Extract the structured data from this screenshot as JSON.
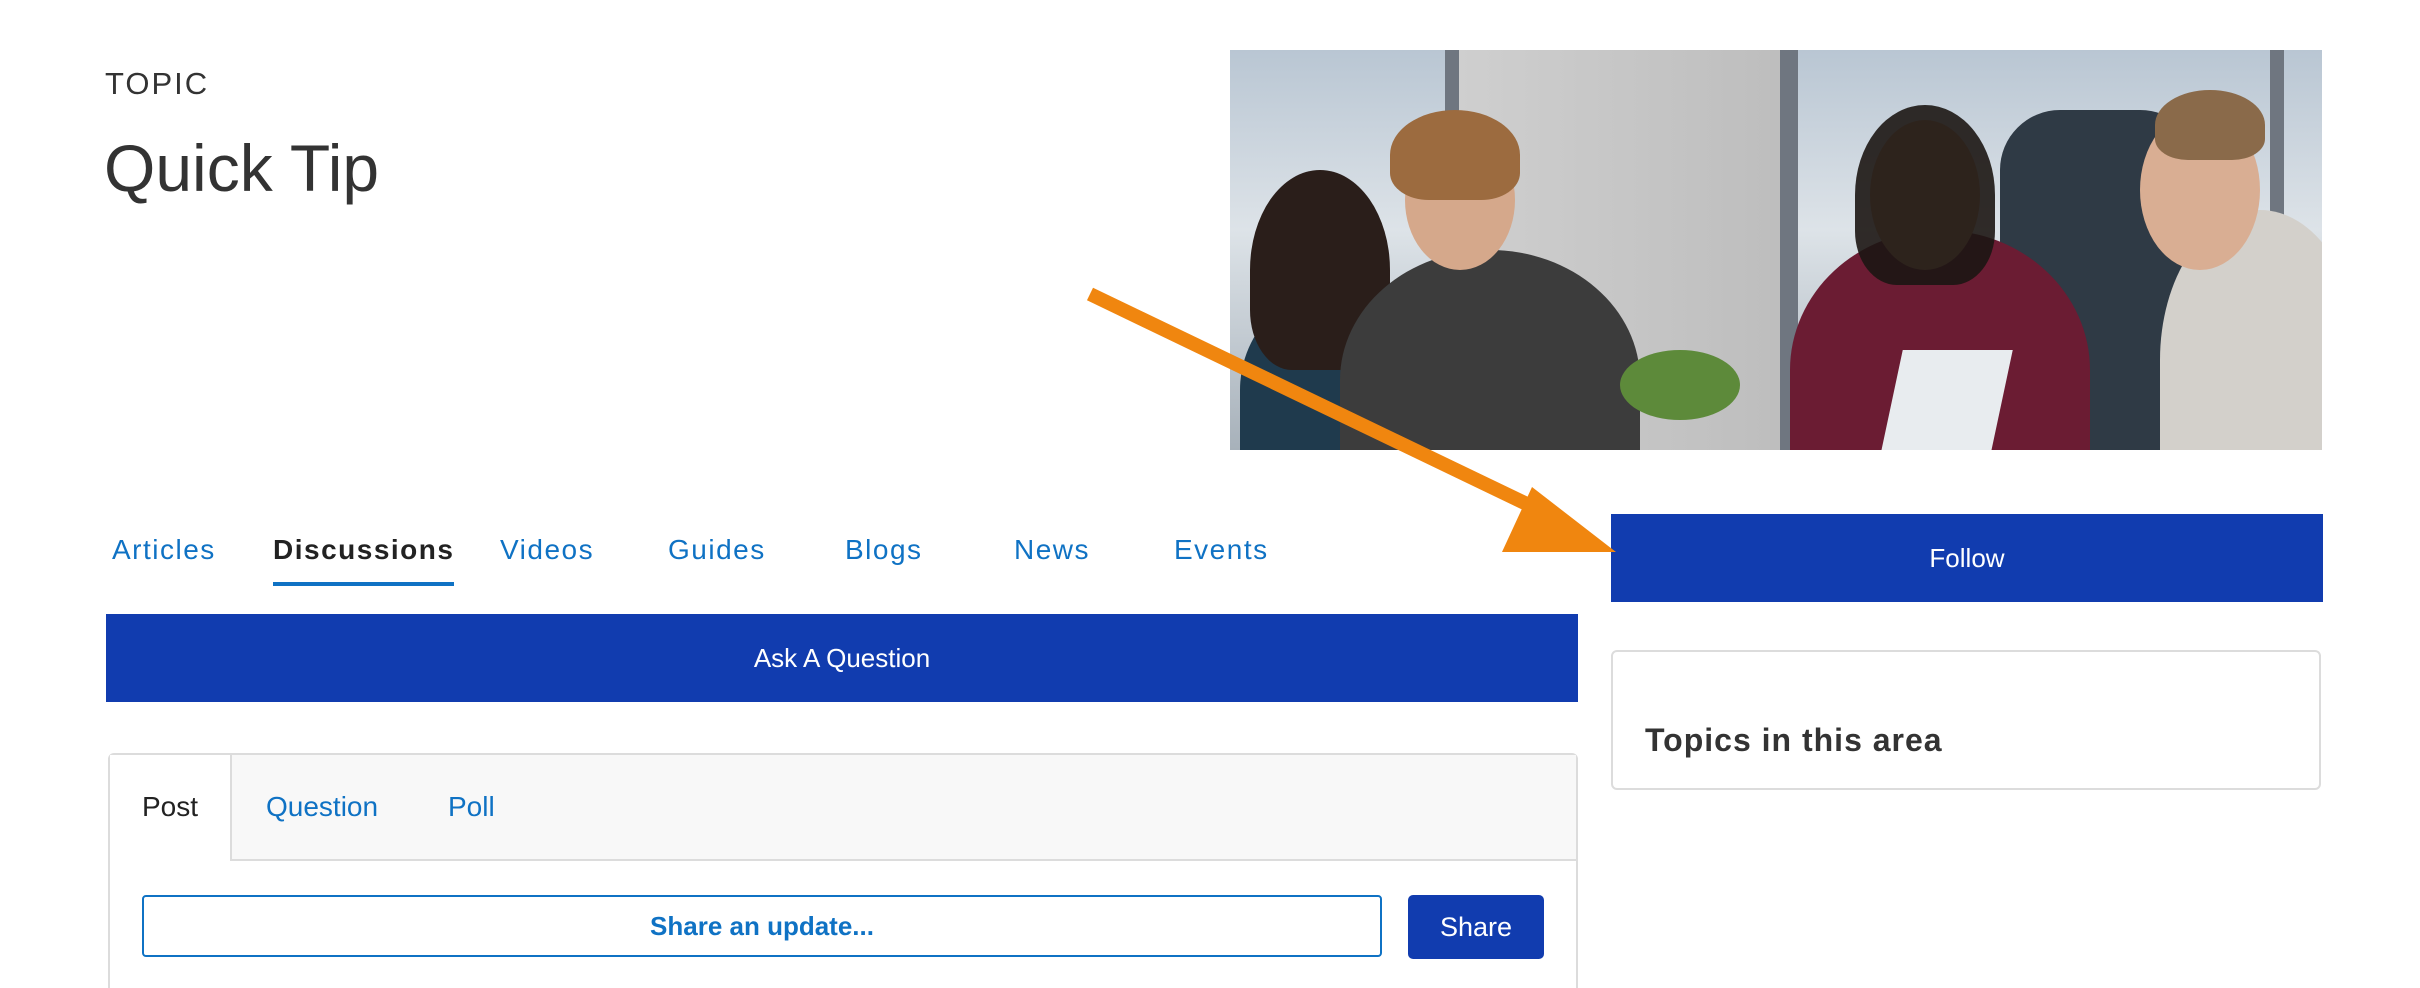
{
  "header": {
    "eyebrow": "TOPIC",
    "title": "Quick Tip"
  },
  "hero_image": {
    "description_icon": "meeting-photo"
  },
  "nav": {
    "tabs": [
      {
        "label": "Articles",
        "active": false
      },
      {
        "label": "Discussions",
        "active": true
      },
      {
        "label": "Videos",
        "active": false
      },
      {
        "label": "Guides",
        "active": false
      },
      {
        "label": "Blogs",
        "active": false
      },
      {
        "label": "News",
        "active": false
      },
      {
        "label": "Events",
        "active": false
      }
    ]
  },
  "ask_button": "Ask A Question",
  "composer": {
    "tabs": [
      {
        "label": "Post",
        "active": true
      },
      {
        "label": "Question",
        "active": false
      },
      {
        "label": "Poll",
        "active": false
      }
    ],
    "input_placeholder": "Share an update...",
    "share_label": "Share"
  },
  "sidebar": {
    "follow_label": "Follow",
    "topics_heading": "Topics in this area"
  },
  "colors": {
    "primary": "#113caf",
    "link": "#0f72c4",
    "annotation_arrow": "#f0860f"
  }
}
